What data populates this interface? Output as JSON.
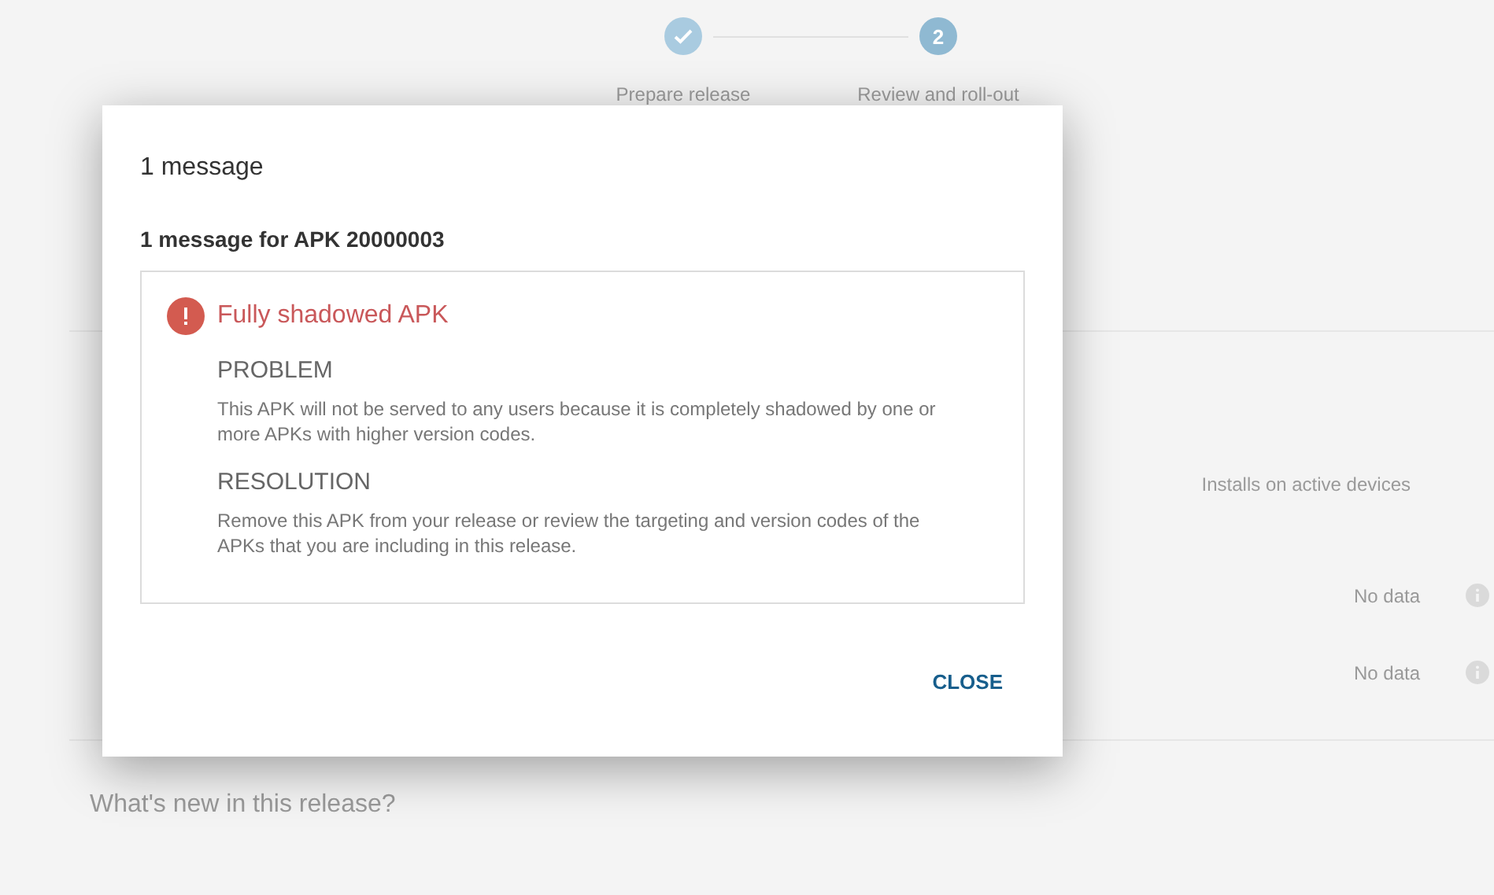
{
  "stepper": {
    "steps": [
      {
        "label": "Prepare release",
        "completed": true
      },
      {
        "number": "2",
        "label": "Review and roll-out",
        "completed": false
      }
    ]
  },
  "background": {
    "section_2": {
      "column_header": "Installs on active devices",
      "rows": [
        {
          "value": "No data"
        },
        {
          "value": "No data"
        }
      ]
    },
    "section_3": {
      "heading": "What's new in this release?"
    }
  },
  "dialog": {
    "title": "1 message",
    "subtitle": "1 message for APK 20000003",
    "messages": [
      {
        "kind": "error",
        "title": "Fully shadowed APK",
        "sections": [
          {
            "heading": "PROBLEM",
            "text": "This APK will not be served to any users because it is completely shadowed by one or more APKs with higher version codes."
          },
          {
            "heading": "RESOLUTION",
            "text": "Remove this APK from your release or review the targeting and version codes of the APKs that you are including in this release."
          }
        ]
      }
    ],
    "buttons": [
      "CLOSE"
    ]
  }
}
